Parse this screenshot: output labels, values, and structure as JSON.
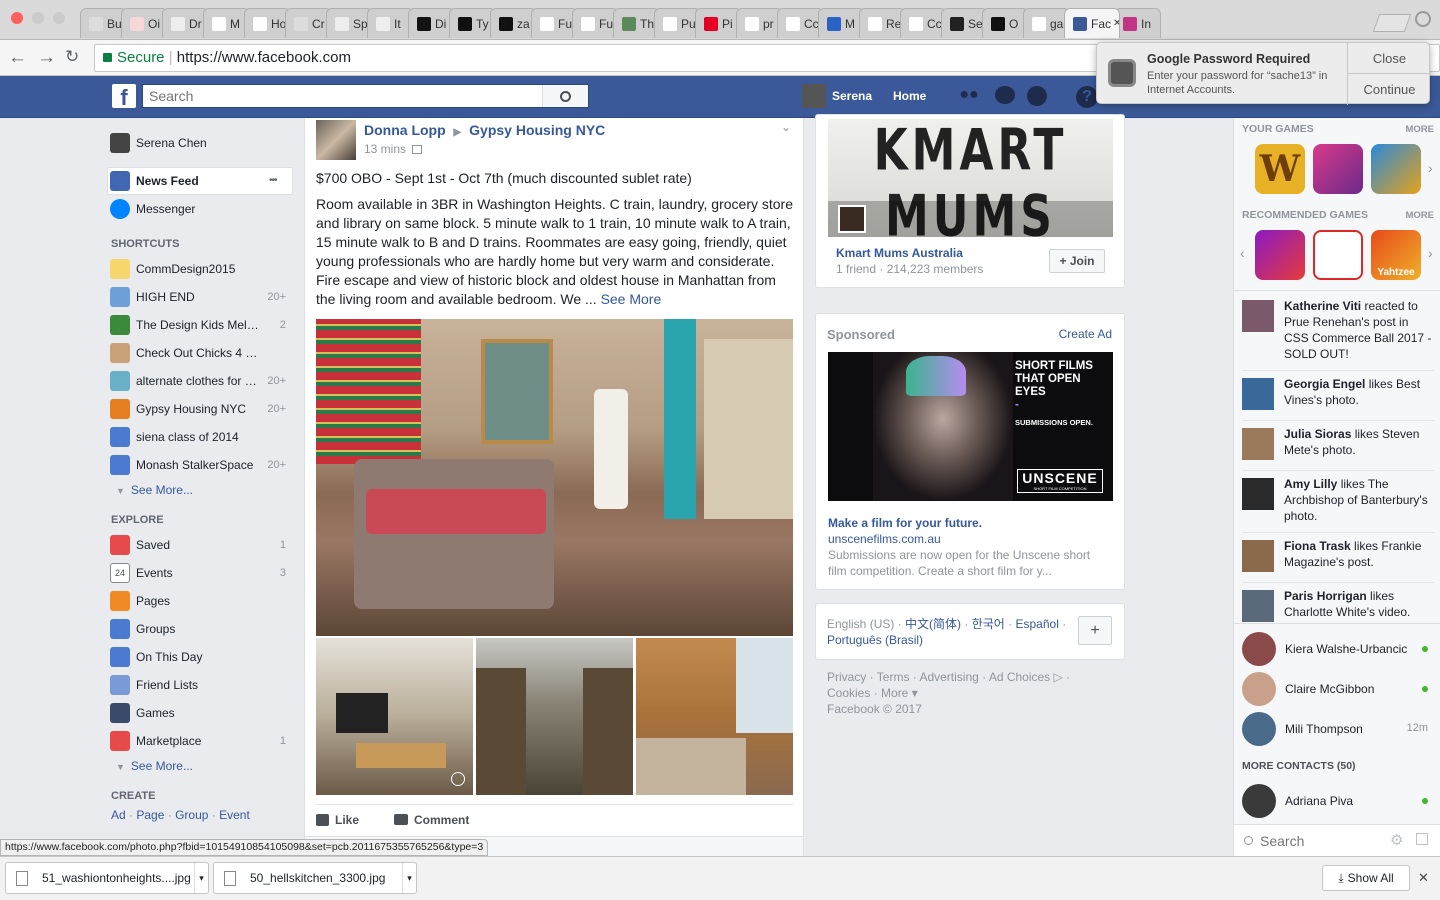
{
  "browser": {
    "tabs": [
      "Bu",
      "Oi",
      "Dr",
      "M",
      "Ho",
      "Cr",
      "Sp",
      "It",
      "Di",
      "Ty",
      "za",
      "Fu",
      "Fu",
      "Th",
      "Pu",
      "Pi",
      "pr",
      "Cc",
      "M",
      "Re",
      "Cc",
      "Se",
      "O",
      "ga",
      "Fac",
      "In"
    ],
    "active_tab": "Fac",
    "url_secure_label": "Secure",
    "url": "https://www.facebook.com"
  },
  "fb_header": {
    "search_placeholder": "Search",
    "user_name": "Serena",
    "home_label": "Home"
  },
  "notification": {
    "title": "Google Password Required",
    "body": "Enter your password for “sache13” in Internet Accounts.",
    "close_label": "Close",
    "continue_label": "Continue"
  },
  "left_nav": {
    "profile_name": "Serena Chen",
    "news_feed": "News Feed",
    "more_dots": "•••",
    "messenger": "Messenger",
    "shortcuts_heading": "SHORTCUTS",
    "shortcuts": [
      {
        "label": "CommDesign2015",
        "count": ""
      },
      {
        "label": "HIGH END",
        "count": "20+"
      },
      {
        "label": "The Design Kids Mel…",
        "count": "2"
      },
      {
        "label": "Check Out Chicks 4 …",
        "count": ""
      },
      {
        "label": "alternate clothes for …",
        "count": "20+"
      },
      {
        "label": "Gypsy Housing NYC",
        "count": "20+"
      },
      {
        "label": "siena class of 2014",
        "count": ""
      },
      {
        "label": "Monash StalkerSpace",
        "count": "20+"
      }
    ],
    "shortcuts_see_more": "See More...",
    "explore_heading": "EXPLORE",
    "explore": [
      {
        "label": "Saved",
        "count": "1"
      },
      {
        "label": "Events",
        "count": "3"
      },
      {
        "label": "Pages",
        "count": ""
      },
      {
        "label": "Groups",
        "count": ""
      },
      {
        "label": "On This Day",
        "count": ""
      },
      {
        "label": "Friend Lists",
        "count": ""
      },
      {
        "label": "Games",
        "count": ""
      },
      {
        "label": "Marketplace",
        "count": "1"
      }
    ],
    "explore_see_more": "See More...",
    "events_icon_day": "24",
    "create_heading": "CREATE",
    "create_links": [
      "Ad",
      "Page",
      "Group",
      "Event"
    ]
  },
  "post": {
    "author": "Donna Lopp",
    "group": "Gypsy Housing NYC",
    "time": "13 mins",
    "headline": "$700 OBO - Sept 1st - Oct 7th (much discounted sublet rate)",
    "body": "Room available in 3BR in Washington Heights. C train, laundry, grocery store and library on same block. 5 minute walk to 1 train, 10 minute walk to A train, 15 minute walk to B and D trains. Roommates are easy going, friendly, quiet young professionals who are hardly home but very warm and considerate. Fire escape and view of historic block and oldest house in Manhattan from the living room and available bedroom. We ...",
    "see_more": "See More",
    "like_label": "Like",
    "comment_label": "Comment"
  },
  "group_suggestion": {
    "banner_line1": "KMART",
    "banner_line2": "MUMS",
    "name": "Kmart Mums Australia",
    "meta": "1 friend · 214,223 members",
    "join_label": "+ Join"
  },
  "sponsored": {
    "heading": "Sponsored",
    "create_ad": "Create Ad",
    "ad_image_text": [
      "SHORT FILMS",
      "THAT OPEN",
      "EYES",
      "-",
      "SUBMISSIONS OPEN."
    ],
    "ad_logo": "UNSCENE",
    "ad_logo_sub": "SHORT FILM COMPETITION",
    "title": "Make a film for your future.",
    "domain": "unscenefilms.com.au",
    "description": "Submissions are now open for the Unscene short film competition. Create a short film for y..."
  },
  "languages": {
    "current": "English (US)",
    "others": [
      "中文(简体)",
      "한국어",
      "Español",
      "Português (Brasil)"
    ],
    "add_label": "+"
  },
  "footer": {
    "links_line1": "Privacy · Terms · Advertising · Ad Choices ▷ ·",
    "links_line2": "Cookies · More ▾",
    "copyright": "Facebook © 2017"
  },
  "sidebar": {
    "your_games": "YOUR GAMES",
    "recommended_games": "RECOMMENDED GAMES",
    "more_label": "MORE",
    "game_labels": [
      "W",
      "Yahtzee"
    ],
    "ticker": [
      {
        "name": "Katherine Viti",
        "text": " reacted to Prue Renehan's post in CSS Commerce Ball 2017 - SOLD OUT!"
      },
      {
        "name": "Georgia Engel",
        "text": " likes Best Vines's photo."
      },
      {
        "name": "Julia Sioras",
        "text": " likes Steven Mete's photo."
      },
      {
        "name": "Amy Lilly",
        "text": " likes The Archbishop of Banterbury's photo."
      },
      {
        "name": "Fiona Trask",
        "text": " likes Frankie Magazine's post."
      },
      {
        "name": "Paris Horrigan",
        "text": " likes Charlotte White's video."
      }
    ],
    "contacts": [
      {
        "name": "Kiera Walshe-Urbancic",
        "status": "online",
        "time": ""
      },
      {
        "name": "Claire McGibbon",
        "status": "online",
        "time": ""
      },
      {
        "name": "Mili Thompson",
        "status": "idle",
        "time": "12m"
      }
    ],
    "more_contacts": "MORE CONTACTS (50)",
    "more_contacts_list": [
      {
        "name": "Adriana Piva",
        "status": "online"
      }
    ],
    "search_placeholder": "Search"
  },
  "status_url": "https://www.facebook.com/photo.php?fbid=10154910854105098&set=pcb.2011675355765256&type=3",
  "downloads": {
    "items": [
      "51_washiontonheights....jpg",
      "50_hellskitchen_3300.jpg"
    ],
    "show_all": "Show All",
    "close": "✕"
  }
}
